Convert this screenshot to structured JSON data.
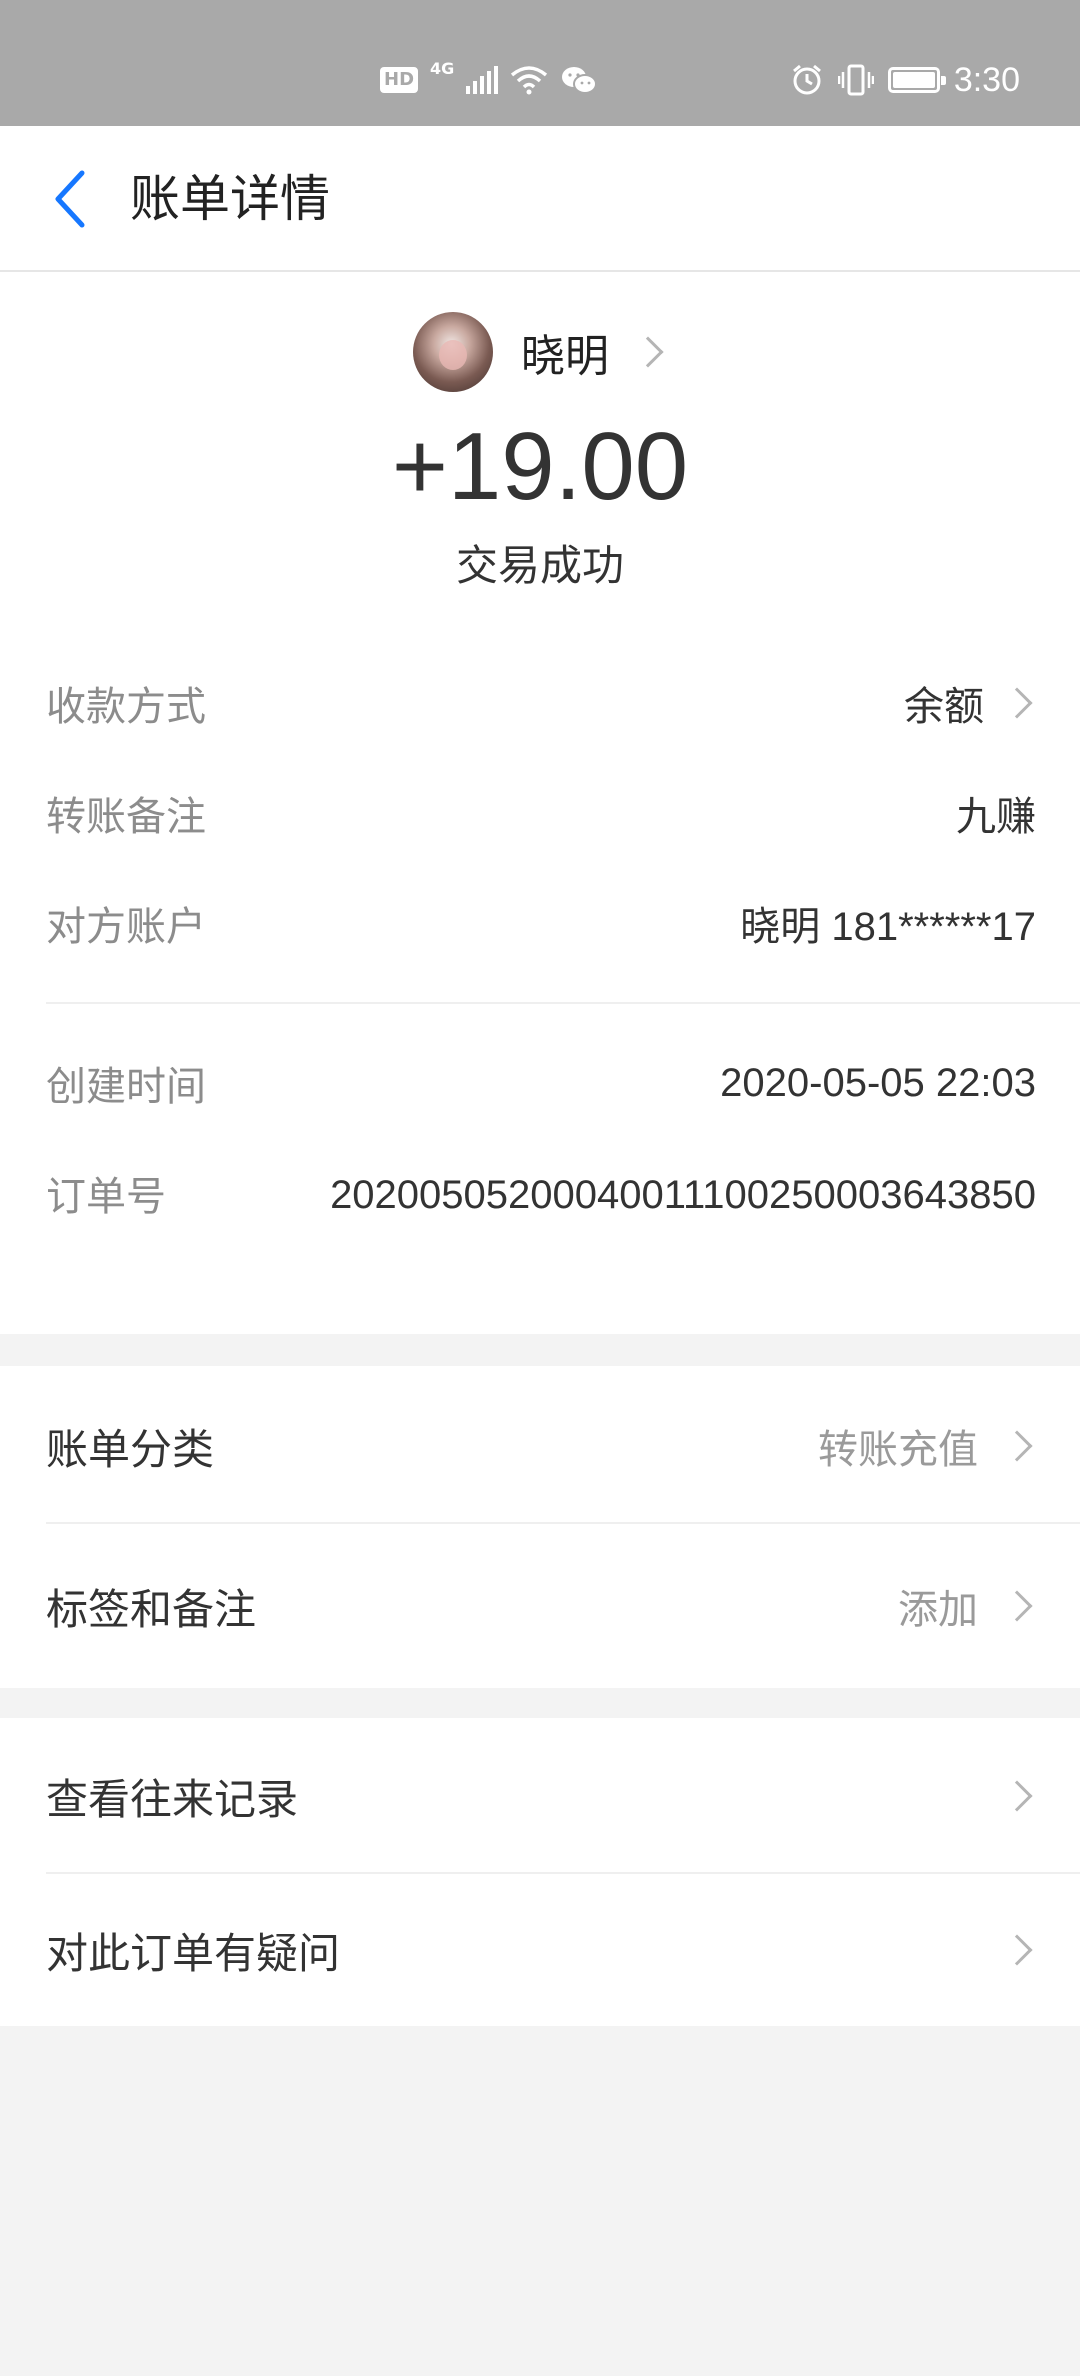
{
  "status_bar": {
    "hd_badge": "HD",
    "network": "4G",
    "time": "3:30"
  },
  "header": {
    "title": "账单详情"
  },
  "summary": {
    "payer_name": "晓明",
    "amount": "+19.00",
    "status": "交易成功"
  },
  "details": [
    {
      "label": "收款方式",
      "value": "余额"
    },
    {
      "label": "转账备注",
      "value": "九赚"
    },
    {
      "label": "对方账户",
      "value": "晓明 181******17"
    },
    {
      "label": "创建时间",
      "value": "2020-05-05 22:03"
    },
    {
      "label": "订单号",
      "value": "20200505200040011100250003643850"
    }
  ],
  "bill_options": {
    "category_label": "账单分类",
    "category_value": "转账充值",
    "tags_label": "标签和备注",
    "tags_value": "添加"
  },
  "more_options": {
    "history_label": "查看往来记录",
    "question_label": "对此订单有疑问"
  },
  "colors": {
    "accent": "#1677ff",
    "status_bar_bg": "#a9a9a9",
    "page_bg": "#f3f3f3"
  }
}
